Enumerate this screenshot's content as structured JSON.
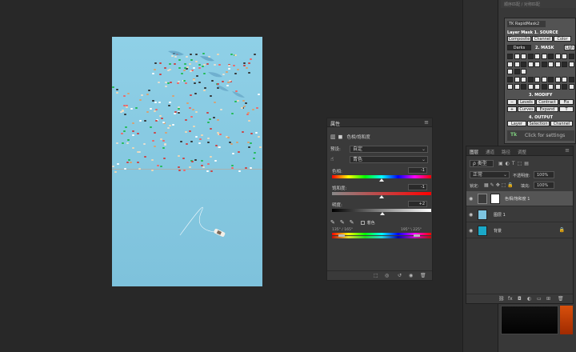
{
  "top_strip": {
    "text": "顺序匹配 / 对称匹配"
  },
  "properties": {
    "tab": "属性",
    "menu": "≡",
    "adjustment_title": "色相/饱和度",
    "preset_label": "预设:",
    "preset_value": "自定",
    "channel_value": "青色",
    "hue_label": "色相:",
    "hue_value": "-1",
    "saturation_label": "饱和度:",
    "saturation_value": "-1",
    "lightness_label": "明度:",
    "lightness_value": "+2",
    "colorize_label": "着色",
    "range_left": "135° / 165°",
    "range_right": "195° \\ 225°"
  },
  "rapidmask": {
    "tab": "TK RapidMask2",
    "section1": "Layer Mask 1. SOURCE",
    "src_buttons": [
      "Composite",
      "Channel",
      "Color"
    ],
    "section2_buttons": [
      "Darks",
      "2. MASK",
      "Ligh"
    ],
    "section3": "3. MODIFY",
    "modify_row1": [
      "Levels",
      "Contract",
      "Fix"
    ],
    "modify_row2": [
      "+",
      "Curves",
      "Expand",
      "T"
    ],
    "section4": "4. OUTPUT",
    "output_buttons": [
      "Layer",
      "Selection",
      "Channel"
    ],
    "footer": "Click for settings"
  },
  "layers": {
    "tabs": [
      "图层",
      "通道",
      "路径",
      "调整"
    ],
    "filter_label": "ρ 类型",
    "blend_mode": "正常",
    "opacity_label": "不透明度:",
    "opacity_value": "100%",
    "lock_label": "锁定:",
    "fill_label": "填充:",
    "fill_value": "100%",
    "items": [
      {
        "name": "色相/饱和度 1",
        "active": true
      },
      {
        "name": "图层 1",
        "active": false
      },
      {
        "name": "背景",
        "active": false
      }
    ],
    "footer_icons": [
      "link-icon",
      "fx-icon",
      "mask-icon",
      "adjustment-icon",
      "folder-icon",
      "new-layer-icon",
      "trash-icon"
    ]
  }
}
